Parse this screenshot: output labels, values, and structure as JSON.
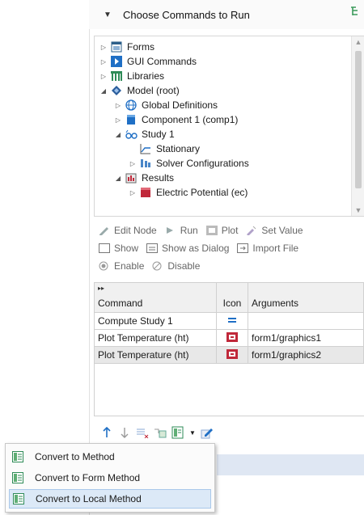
{
  "section": {
    "title": "Choose Commands to Run"
  },
  "tree": [
    {
      "id": "forms",
      "label": "Forms",
      "level": 0,
      "toggle": "collapsed"
    },
    {
      "id": "gui",
      "label": "GUI Commands",
      "level": 0,
      "toggle": "collapsed"
    },
    {
      "id": "libraries",
      "label": "Libraries",
      "level": 0,
      "toggle": "collapsed"
    },
    {
      "id": "model",
      "label": "Model (root)",
      "level": 0,
      "toggle": "expanded"
    },
    {
      "id": "global",
      "label": "Global Definitions",
      "level": 1,
      "toggle": "collapsed"
    },
    {
      "id": "component",
      "label": "Component 1 (comp1)",
      "level": 1,
      "toggle": "collapsed"
    },
    {
      "id": "study",
      "label": "Study 1",
      "level": 1,
      "toggle": "expanded"
    },
    {
      "id": "stationary",
      "label": "Stationary",
      "level": 2,
      "toggle": "none"
    },
    {
      "id": "solver",
      "label": "Solver Configurations",
      "level": 2,
      "toggle": "collapsed"
    },
    {
      "id": "results",
      "label": "Results",
      "level": 1,
      "toggle": "expanded"
    },
    {
      "id": "ec",
      "label": "Electric Potential (ec)",
      "level": 2,
      "toggle": "collapsed"
    }
  ],
  "toolbar": {
    "edit_node": "Edit Node",
    "run": "Run",
    "plot": "Plot",
    "set_value": "Set Value",
    "show": "Show",
    "show_as_dialog": "Show as Dialog",
    "import_file": "Import File",
    "enable": "Enable",
    "disable": "Disable"
  },
  "table": {
    "headers": {
      "command": "Command",
      "icon": "Icon",
      "arguments": "Arguments"
    },
    "rows": [
      {
        "command": "Compute Study 1",
        "icon": "compute-icon",
        "arguments": ""
      },
      {
        "command": "Plot Temperature (ht)",
        "icon": "plot-icon",
        "arguments": "form1/graphics1"
      },
      {
        "command": "Plot Temperature (ht)",
        "icon": "plot-icon",
        "arguments": "form1/graphics2"
      }
    ]
  },
  "context_menu": [
    {
      "label": "Convert to Method"
    },
    {
      "label": "Convert to Form Method"
    },
    {
      "label": "Convert to Local Method"
    }
  ],
  "colors": {
    "accent": "#1a6fc9",
    "highlight": "#dce9f7",
    "grid_green": "#2e8b57",
    "plot_red": "#c0283a"
  }
}
